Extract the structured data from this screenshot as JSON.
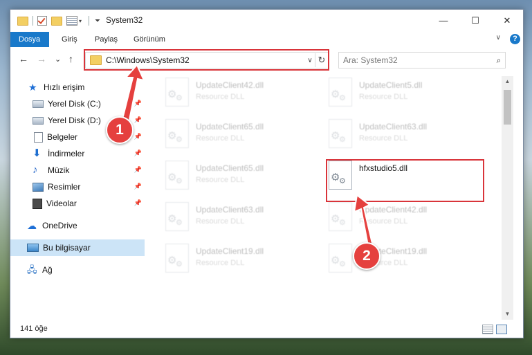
{
  "window": {
    "title": "System32",
    "minimize": "—",
    "maximize": "☐",
    "close": "✕"
  },
  "ribbon": {
    "tabs": [
      "Dosya",
      "Giriş",
      "Paylaş",
      "Görünüm"
    ],
    "help": "?",
    "collapse": "∨"
  },
  "nav": {
    "back": "←",
    "forward": "→",
    "recent": "⌄",
    "up": "↑",
    "address": "C:\\Windows\\System32",
    "address_dropdown": "∨",
    "refresh": "↻",
    "search_placeholder": "Ara: System32",
    "search_icon": "⌕"
  },
  "sidebar": {
    "items": [
      {
        "label": "Hızlı erişim",
        "icon": "star-icon"
      },
      {
        "label": "Yerel Disk (C:)",
        "icon": "drive-icon",
        "pinned": true
      },
      {
        "label": "Yerel Disk (D:)",
        "icon": "drive-icon",
        "pinned": true
      },
      {
        "label": "Belgeler",
        "icon": "document-icon",
        "pinned": true
      },
      {
        "label": "İndirmeler",
        "icon": "download-icon",
        "pinned": true
      },
      {
        "label": "Müzik",
        "icon": "music-icon",
        "pinned": true
      },
      {
        "label": "Resimler",
        "icon": "pictures-icon",
        "pinned": true
      },
      {
        "label": "Videolar",
        "icon": "video-icon",
        "pinned": true
      },
      {
        "label": "OneDrive",
        "icon": "cloud-icon"
      },
      {
        "label": "Bu bilgisayar",
        "icon": "computer-icon",
        "selected": true
      },
      {
        "label": "Ağ",
        "icon": "network-icon"
      }
    ],
    "pin_glyph": "📌"
  },
  "files": [
    {
      "name": "UpdateClient42.dll",
      "desc": "Resource DLL"
    },
    {
      "name": "UpdateClient5.dll",
      "desc": "Resource DLL"
    },
    {
      "name": "UpdateClient65.dll",
      "desc": "Resource DLL"
    },
    {
      "name": "UpdateClient63.dll",
      "desc": "Resource DLL"
    },
    {
      "name": "UpdateClient65.dll",
      "desc": "Resource DLL"
    },
    {
      "name": "hfxstudio5.dll",
      "desc": "",
      "highlighted": true
    },
    {
      "name": "UpdateClient63.dll",
      "desc": "Resource DLL"
    },
    {
      "name": "UpdateClient42.dll",
      "desc": "Resource DLL"
    },
    {
      "name": "UpdateClient19.dll",
      "desc": "Resource DLL"
    },
    {
      "name": "UpdateClient19.dll",
      "desc": "Resource DLL"
    }
  ],
  "status": {
    "item_count": "141 öğe"
  },
  "scrollbar": {
    "up": "▲",
    "down": "▼"
  },
  "annotations": {
    "callout_1": "1",
    "callout_2": "2",
    "highlight_color": "#d9343a"
  }
}
